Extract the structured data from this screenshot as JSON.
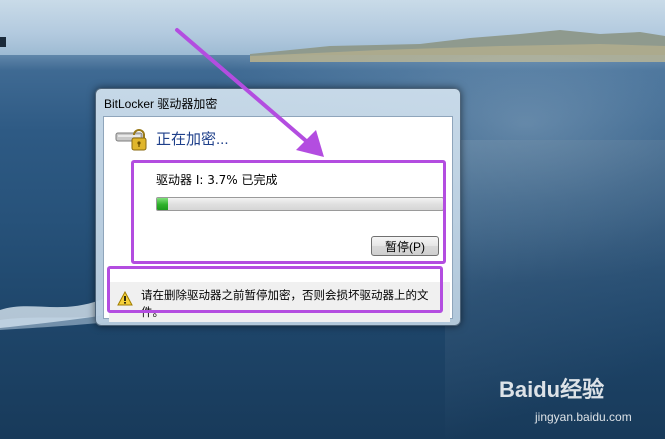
{
  "dialog": {
    "title": "BitLocker 驱动器加密",
    "heading": "正在加密...",
    "status_text": "驱动器 I: 3.7% 已完成",
    "progress": 0.037,
    "pause_button": "暂停(P)",
    "warning_text": "请在删除驱动器之前暂停加密，否则会损坏驱动器上的文件。"
  },
  "icons": {
    "dialog_icon": "bitlocker-lock-icon",
    "warning_icon": "warning-triangle-icon"
  },
  "annotations": {
    "highlight_color": "#b34de0",
    "arrow_color": "#b34de0"
  },
  "watermark": {
    "brand": "Baidu经验",
    "url": "jingyan.baidu.com"
  }
}
